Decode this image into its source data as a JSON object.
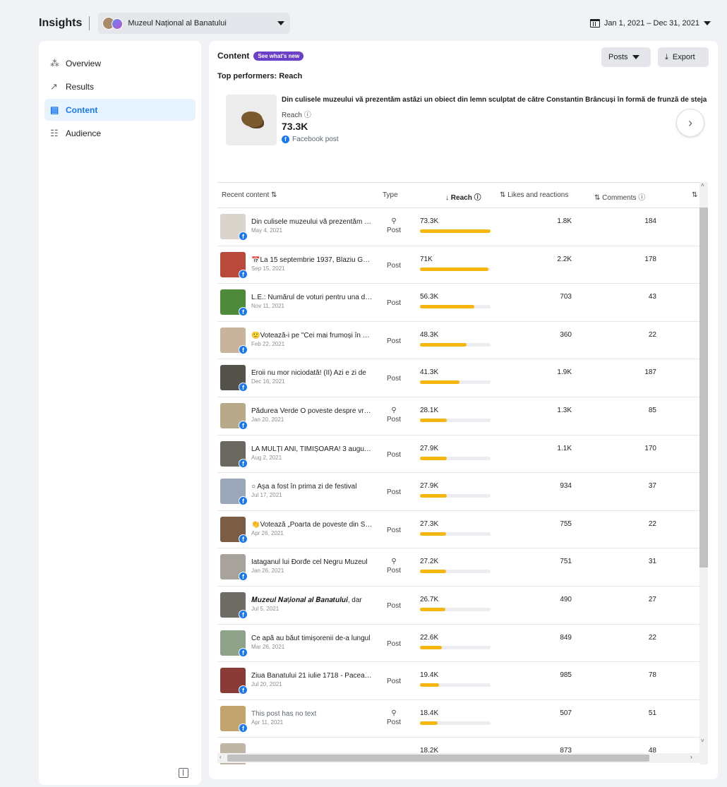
{
  "header": {
    "title": "Insights",
    "page_name": "Muzeul Național al Banatului",
    "date_range": "Jan 1, 2021 – Dec 31, 2021"
  },
  "sidebar": {
    "items": [
      {
        "label": "Overview",
        "icon": "overview-icon"
      },
      {
        "label": "Results",
        "icon": "results-icon"
      },
      {
        "label": "Content",
        "icon": "content-icon",
        "active": true
      },
      {
        "label": "Audience",
        "icon": "audience-icon"
      }
    ]
  },
  "content": {
    "title": "Content",
    "badge": "See what's new",
    "posts_label": "Posts",
    "export_label": "Export",
    "top_performers_title": "Top performers: Reach",
    "top_post": {
      "text": "Din culisele muzeului vă prezentăm astăzi un obiect din lemn sculptat de către Constantin Brâncuși în formă de frunză de steja",
      "metric_label": "Reach",
      "metric_value": "73.3K",
      "source": "Facebook post"
    }
  },
  "table": {
    "columns": {
      "recent": "Recent content",
      "type": "Type",
      "reach": "Reach",
      "likes": "Likes and reactions",
      "comments": "Comments"
    },
    "rows": [
      {
        "text": "Din culisele muzeului vă prezentăm astăzi",
        "date": "May 4, 2021",
        "type": "Post",
        "boosted": true,
        "reach": "73.3K",
        "reach_pct": 1.0,
        "likes": "1.8K",
        "comments": "184",
        "thumb": "#d9d4cc",
        "muted": false
      },
      {
        "text": "📅La 15 septembrie 1937, Blaziu Gurgu",
        "date": "Sep 15, 2021",
        "type": "Post",
        "boosted": false,
        "reach": "71K",
        "reach_pct": 0.97,
        "likes": "2.2K",
        "comments": "178",
        "thumb": "#b94a3b",
        "muted": false
      },
      {
        "text": "L.E.: Numărul de voturi pentru una dintre",
        "date": "Nov 11, 2021",
        "type": "Post",
        "boosted": false,
        "reach": "56.3K",
        "reach_pct": 0.77,
        "likes": "703",
        "comments": "43",
        "thumb": "#4f8a3a",
        "muted": false
      },
      {
        "text": "🙂Votează-i pe \"Cei mai frumoși în straie",
        "date": "Feb 22, 2021",
        "type": "Post",
        "boosted": false,
        "reach": "48.3K",
        "reach_pct": 0.66,
        "likes": "360",
        "comments": "22",
        "thumb": "#c8b49c",
        "muted": false
      },
      {
        "text": "Eroii nu mor niciodată! (II) Azi e zi de",
        "date": "Dec 16, 2021",
        "type": "Post",
        "boosted": false,
        "reach": "41.3K",
        "reach_pct": 0.56,
        "likes": "1.9K",
        "comments": "187",
        "thumb": "#55524c",
        "muted": false
      },
      {
        "text": "Pădurea Verde O poveste despre vremuri",
        "date": "Jan 20, 2021",
        "type": "Post",
        "boosted": true,
        "reach": "28.1K",
        "reach_pct": 0.38,
        "likes": "1.3K",
        "comments": "85",
        "thumb": "#b8a98a",
        "muted": false
      },
      {
        "text": "LA MULȚI ANI, TIMIȘOARA! 3 august 1716",
        "date": "Aug 2, 2021",
        "type": "Post",
        "boosted": false,
        "reach": "27.9K",
        "reach_pct": 0.38,
        "likes": "1.1K",
        "comments": "170",
        "thumb": "#6b6862",
        "muted": false
      },
      {
        "text": "○ Așa a fost în prima zi de festival",
        "date": "Jul 17, 2021",
        "type": "Post",
        "boosted": false,
        "reach": "27.9K",
        "reach_pct": 0.38,
        "likes": "934",
        "comments": "37",
        "thumb": "#9aa7b8",
        "muted": false
      },
      {
        "text": "👏Votează „Poarta de poveste din Sânmihaiu",
        "date": "Apr 26, 2021",
        "type": "Post",
        "boosted": false,
        "reach": "27.3K",
        "reach_pct": 0.37,
        "likes": "755",
        "comments": "22",
        "thumb": "#7a5d44",
        "muted": false
      },
      {
        "text": "Iataganul lui Đorđe cel Negru Muzeul",
        "date": "Jan 26, 2021",
        "type": "Post",
        "boosted": true,
        "reach": "27.2K",
        "reach_pct": 0.37,
        "likes": "751",
        "comments": "31",
        "thumb": "#a7a39c",
        "muted": false
      },
      {
        "text": "𝑴𝒖𝒛𝒆𝒖𝒍 𝑵𝒂ț𝒊𝒐𝒏𝒂𝒍 𝒂𝒍 𝑩𝒂𝒏𝒂𝒕𝒖𝒍𝒖𝒊, dar",
        "date": "Jul 5, 2021",
        "type": "Post",
        "boosted": false,
        "reach": "26.7K",
        "reach_pct": 0.36,
        "likes": "490",
        "comments": "27",
        "thumb": "#6f6c66",
        "muted": false
      },
      {
        "text": "Ce apă au băut timișorenii de-a lungul",
        "date": "Mar 26, 2021",
        "type": "Post",
        "boosted": false,
        "reach": "22.6K",
        "reach_pct": 0.31,
        "likes": "849",
        "comments": "22",
        "thumb": "#8fa38a",
        "muted": false
      },
      {
        "text": "Ziua Banatului 21 iulie 1718 - Pacea de",
        "date": "Jul 20, 2021",
        "type": "Post",
        "boosted": false,
        "reach": "19.4K",
        "reach_pct": 0.27,
        "likes": "985",
        "comments": "78",
        "thumb": "#8a3b35",
        "muted": false
      },
      {
        "text": "This post has no text",
        "date": "Apr 11, 2021",
        "type": "Post",
        "boosted": true,
        "reach": "18.4K",
        "reach_pct": 0.25,
        "likes": "507",
        "comments": "51",
        "thumb": "#c1a46e",
        "muted": true
      },
      {
        "text": "",
        "date": "",
        "type": "",
        "boosted": false,
        "reach": "18.2K",
        "reach_pct": 0.25,
        "likes": "873",
        "comments": "48",
        "thumb": "#bfb6a6",
        "muted": false
      }
    ]
  }
}
